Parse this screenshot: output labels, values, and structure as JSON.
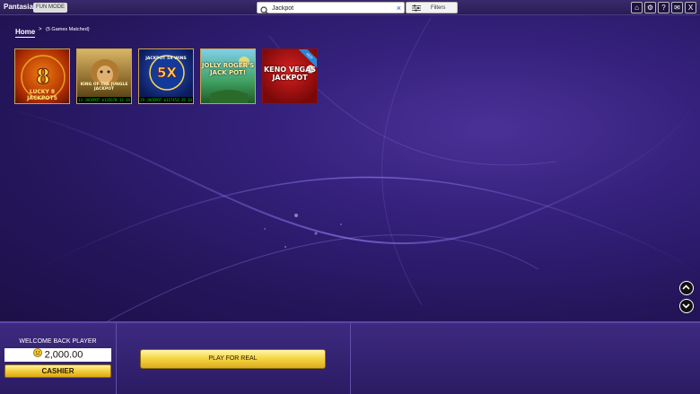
{
  "topbar": {
    "brand": "Pantasia",
    "mode_badge": "FUN MODE",
    "search": {
      "value": "Jackpot",
      "placeholder": "",
      "clear": "×"
    },
    "filters_label": "Filters",
    "window_buttons": [
      "⌂",
      "⚙",
      "?",
      "✉",
      "X"
    ]
  },
  "breadcrumb": {
    "home": "Home",
    "separator": ">",
    "count": "(5 Games Matched)"
  },
  "games": [
    {
      "title": "LUCKY 8 JACKPOTS",
      "icon": "lucky-jackpots-icon"
    },
    {
      "title": "KING OF THE JUNGLE JACKPOT",
      "icon": "lion-icon",
      "ticker": "13 JACKPOT $135678 13 34"
    },
    {
      "title": "JACKPOT 5X WINS",
      "icon": "5x-wins-icon",
      "ticker": "29 JACKPOT $117452 29 34"
    },
    {
      "title": "JOLLY ROGER'S JACK POT!",
      "icon": "pirate-icon"
    },
    {
      "title": "KENO VEGAS JACKPOT",
      "icon": "keno-icon",
      "badge": "HOT"
    }
  ],
  "bottom": {
    "welcome": "WELCOME BACK PLAYER",
    "balance": "2,000.00",
    "cashier": "CASHIER",
    "play_for_real": "PLAY FOR REAL"
  },
  "colors": {
    "accent_gold": "#f2c930",
    "background_purple": "#2a1a5e",
    "tile_border": "#c9a445"
  }
}
